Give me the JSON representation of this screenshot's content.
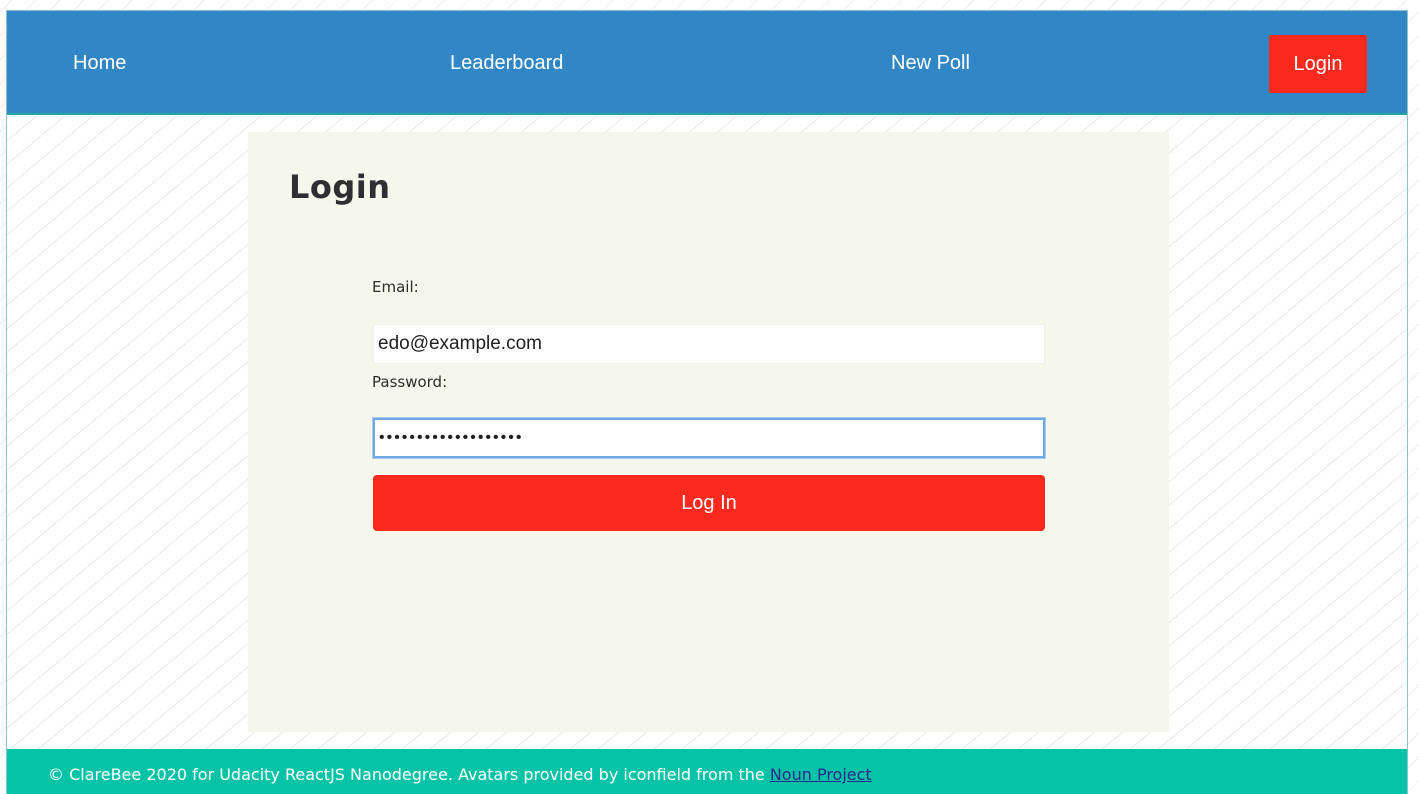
{
  "nav": {
    "home": "Home",
    "leaderboard": "Leaderboard",
    "new_poll": "New Poll",
    "login": "Login"
  },
  "login_card": {
    "title": "Login",
    "email_label": "Email:",
    "email_value": "edo@example.com",
    "password_label": "Password:",
    "password_value": "•••••••••••••••••••",
    "submit_label": "Log In"
  },
  "footer": {
    "text": "© ClareBee 2020 for Udacity ReactJS Nanodegree. Avatars provided by iconfield from the ",
    "link_text": "Noun Project"
  },
  "colors": {
    "navbar": "#3187c6",
    "accent_red": "#fc2a1e",
    "card_background": "#f5f6ec",
    "footer": "#05c3a7"
  }
}
